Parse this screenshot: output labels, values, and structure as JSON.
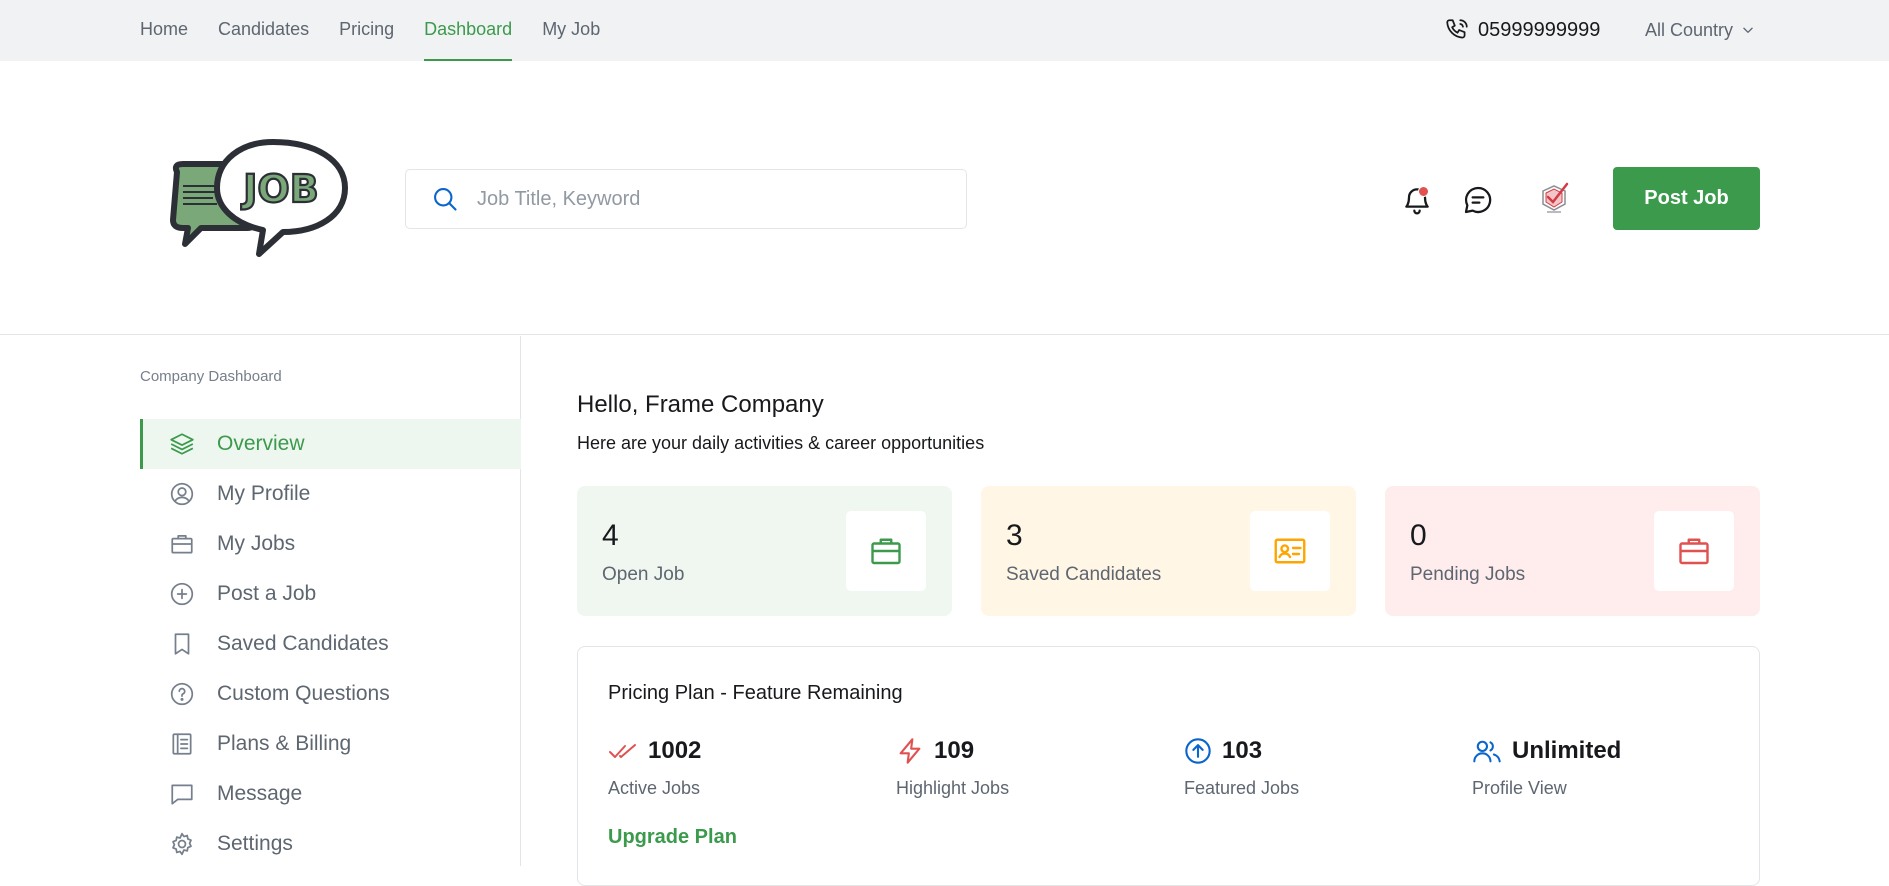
{
  "topnav": {
    "items": [
      {
        "label": "Home",
        "active": false
      },
      {
        "label": "Candidates",
        "active": false
      },
      {
        "label": "Pricing",
        "active": false
      },
      {
        "label": "Dashboard",
        "active": true
      },
      {
        "label": "My Job",
        "active": false
      }
    ],
    "phone": "05999999999",
    "country": "All Country"
  },
  "header": {
    "logo_text": "JOB",
    "search_placeholder": "Job Title, Keyword",
    "search_value": "",
    "post_job_label": "Post Job",
    "has_notification": true
  },
  "sidebar": {
    "title": "Company Dashboard",
    "items": [
      {
        "label": "Overview",
        "icon": "layers-icon",
        "active": true
      },
      {
        "label": "My Profile",
        "icon": "user-circle-icon",
        "active": false
      },
      {
        "label": "My Jobs",
        "icon": "briefcase-icon",
        "active": false
      },
      {
        "label": "Post a Job",
        "icon": "plus-circle-icon",
        "active": false
      },
      {
        "label": "Saved Candidates",
        "icon": "bookmark-icon",
        "active": false
      },
      {
        "label": "Custom Questions",
        "icon": "question-circle-icon",
        "active": false
      },
      {
        "label": "Plans & Billing",
        "icon": "notebook-icon",
        "active": false
      },
      {
        "label": "Message",
        "icon": "chat-icon",
        "active": false
      },
      {
        "label": "Settings",
        "icon": "gear-icon",
        "active": false
      }
    ]
  },
  "main": {
    "greeting": "Hello, Frame Company",
    "subtitle": "Here are your daily activities & career opportunities",
    "stats": [
      {
        "value": "4",
        "label": "Open Job",
        "icon": "briefcase-icon",
        "bg": "#f0f7f1",
        "color": "#3c9a4c"
      },
      {
        "value": "3",
        "label": "Saved Candidates",
        "icon": "id-card-icon",
        "bg": "#fff6e6",
        "color": "#ffa500"
      },
      {
        "value": "0",
        "label": "Pending Jobs",
        "icon": "briefcase-icon",
        "bg": "#ffeced",
        "color": "#e05151"
      }
    ],
    "plan": {
      "title": "Pricing Plan - Feature Remaining",
      "features": [
        {
          "value": "1002",
          "label": "Active Jobs",
          "icon": "double-check-icon",
          "color": "#e05151"
        },
        {
          "value": "109",
          "label": "Highlight Jobs",
          "icon": "lightning-icon",
          "color": "#e05151"
        },
        {
          "value": "103",
          "label": "Featured Jobs",
          "icon": "arrow-up-circle-icon",
          "color": "#0a65cc"
        },
        {
          "value": "Unlimited",
          "label": "Profile View",
          "icon": "users-icon",
          "color": "#0a65cc"
        }
      ],
      "upgrade_label": "Upgrade Plan"
    }
  }
}
